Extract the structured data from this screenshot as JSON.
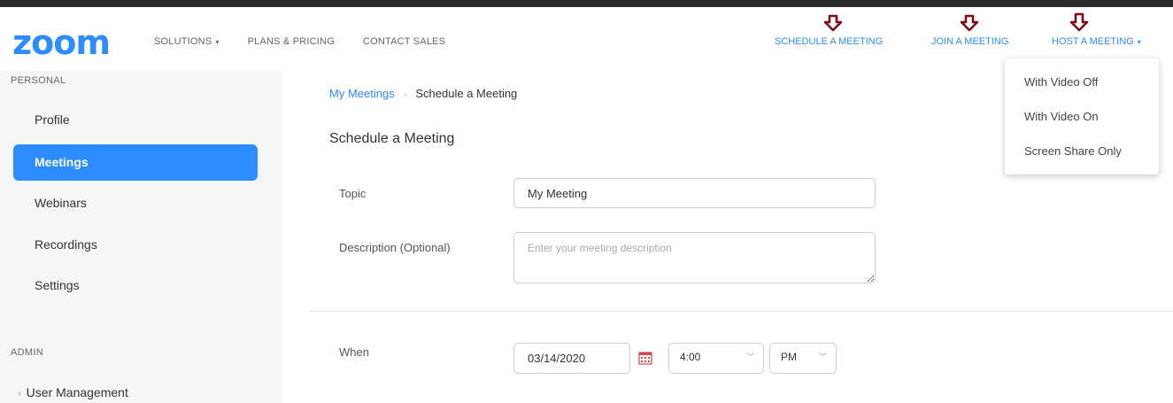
{
  "brand": {
    "logo_text": "zoom",
    "accent": "#2d8cff"
  },
  "header": {
    "nav_left": [
      {
        "label": "SOLUTIONS",
        "has_caret": true
      },
      {
        "label": "PLANS & PRICING"
      },
      {
        "label": "CONTACT SALES"
      }
    ],
    "nav_right": {
      "schedule": "SCHEDULE A MEETING",
      "join": "JOIN A MEETING",
      "host": "HOST A MEETING"
    },
    "annotation_arrow_color": "#7a0d17"
  },
  "host_dropdown": {
    "items": [
      "With Video Off",
      "With Video On",
      "Screen Share Only"
    ]
  },
  "sidebar": {
    "personal_label": "PERSONAL",
    "items": [
      "Profile",
      "Meetings",
      "Webinars",
      "Recordings",
      "Settings"
    ],
    "active": "Meetings",
    "admin_label": "ADMIN",
    "admin_items": [
      "User Management"
    ]
  },
  "breadcrumb": {
    "link": "My Meetings",
    "current": "Schedule a Meeting"
  },
  "page_title": "Schedule a Meeting",
  "form": {
    "topic_label": "Topic",
    "topic_value": "My Meeting",
    "description_label": "Description (Optional)",
    "description_placeholder": "Enter your meeting description",
    "when_label": "When",
    "date_value": "03/14/2020",
    "time_value": "4:00",
    "ampm_value": "PM"
  },
  "icons": {
    "calendar": "calendar-icon",
    "caret": "chevron-down-icon",
    "annotation": "down-arrow-icon"
  }
}
